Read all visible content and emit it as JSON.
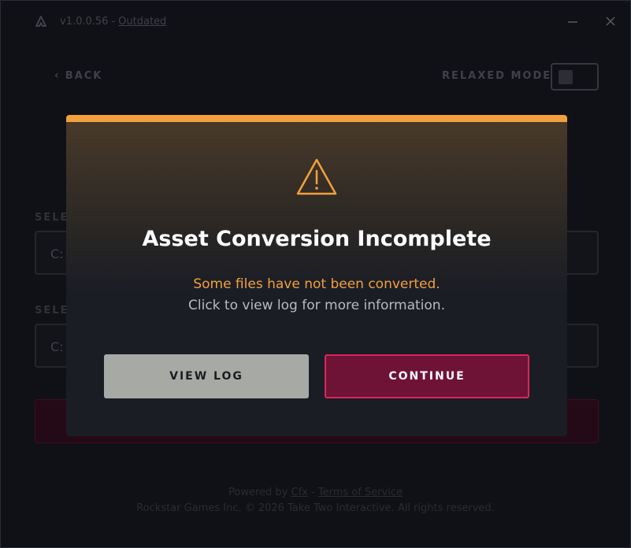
{
  "titlebar": {
    "version": "v1.0.0.56",
    "separator": "-",
    "status_link": "Outdated",
    "minimize_icon": "minimize-icon",
    "close_icon": "close-icon"
  },
  "header": {
    "back_label": "BACK",
    "relaxed_mode_label": "RELAXED MODE"
  },
  "fields": [
    {
      "label": "SELE",
      "value": "C:"
    },
    {
      "label": "SELE",
      "value": "C:"
    }
  ],
  "footer": {
    "powered_prefix": "Powered by ",
    "powered_link": "Cfx",
    "separator": " - ",
    "terms_link": "Terms of Service",
    "copyright": "Rockstar Games Inc. © 2026 Take Two Interactive. All rights reserved."
  },
  "modal": {
    "icon": "warning-icon",
    "title": "Asset Conversion Incomplete",
    "message": "Some files have not been converted.",
    "sub_message": "Click to view log for more information.",
    "view_log_label": "VIEW LOG",
    "continue_label": "CONTINUE"
  },
  "colors": {
    "accent_orange": "#f2a03d",
    "continue_bg": "#6e1336",
    "continue_border": "#d9275a",
    "view_log_bg": "#a7a9a4"
  }
}
